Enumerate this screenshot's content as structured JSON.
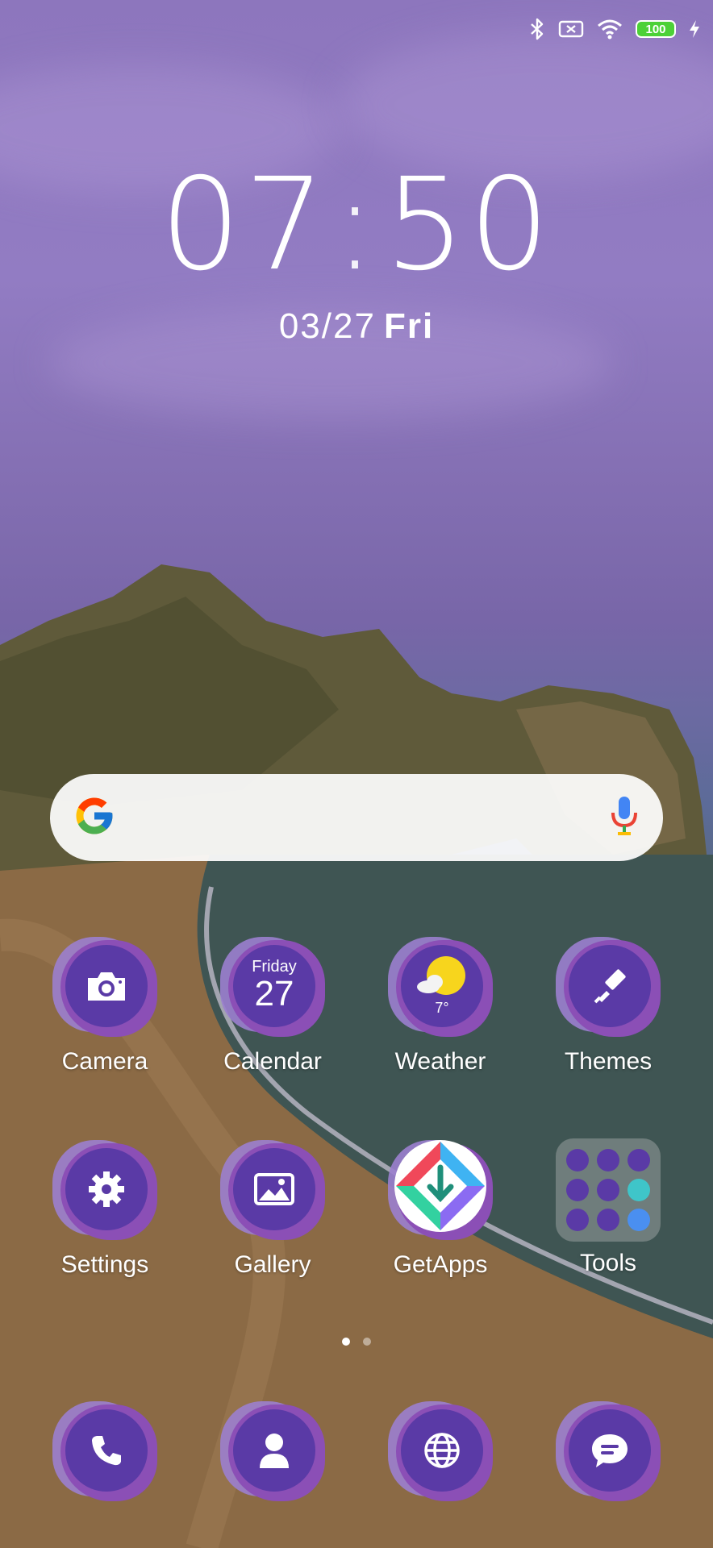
{
  "status_bar": {
    "icons": [
      "bluetooth-icon",
      "no-sim-icon",
      "wifi-icon",
      "charging-bolt-icon"
    ],
    "battery_level": "100"
  },
  "clock": {
    "hours": "07",
    "minutes": "50",
    "date": "03/27",
    "weekday": "Fri"
  },
  "search": {
    "logo": "google-g-icon",
    "voice": "microphone-icon"
  },
  "apps": [
    {
      "label": "Camera",
      "icon": "camera-icon"
    },
    {
      "label": "Calendar",
      "icon": "calendar-icon",
      "day_name": "Friday",
      "day_number": "27"
    },
    {
      "label": "Weather",
      "icon": "sun-cloud-icon",
      "temperature": "7°"
    },
    {
      "label": "Themes",
      "icon": "paintbrush-icon"
    },
    {
      "label": "Settings",
      "icon": "gear-icon"
    },
    {
      "label": "Gallery",
      "icon": "image-icon"
    },
    {
      "label": "GetApps",
      "icon": "download-arrow-icon"
    },
    {
      "label": "Tools",
      "icon": "folder-icon"
    }
  ],
  "pages": {
    "count": 2,
    "active": 1
  },
  "dock": [
    {
      "name": "Phone",
      "icon": "phone-icon"
    },
    {
      "name": "Contacts",
      "icon": "contact-icon"
    },
    {
      "name": "Browser",
      "icon": "globe-icon"
    },
    {
      "name": "Messages",
      "icon": "message-icon"
    }
  ],
  "colors": {
    "icon_bg": "#5a3aa6",
    "icon_blob": "#9b7fcf",
    "battery_green": "#4cd137"
  }
}
